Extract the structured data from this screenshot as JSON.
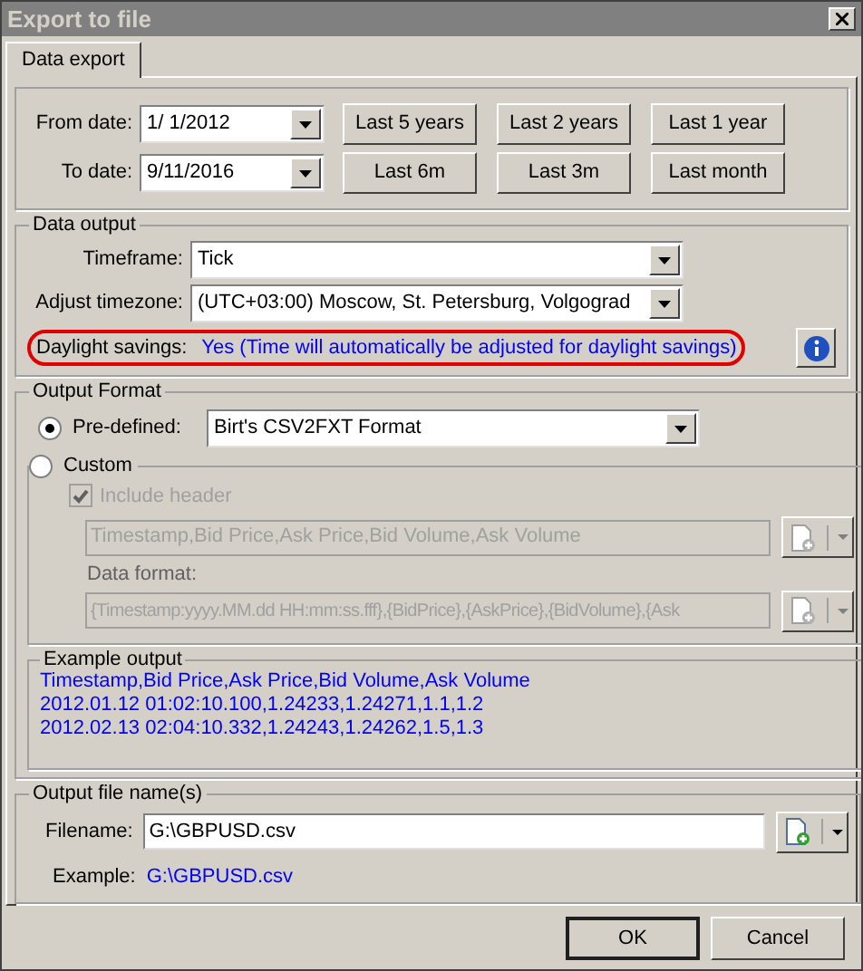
{
  "window": {
    "title": "Export to file"
  },
  "tabs": [
    {
      "label": "Data export",
      "selected": true
    }
  ],
  "date_range": {
    "from": {
      "label": "From date:",
      "value": "1/  1/2012"
    },
    "to": {
      "label": "To date:",
      "value": "9/11/2016"
    },
    "presets": [
      "Last 5 years",
      "Last 2 years",
      "Last 1 year",
      "Last 6m",
      "Last 3m",
      "Last month"
    ]
  },
  "data_output": {
    "title": "Data output",
    "timeframe": {
      "label": "Timeframe:",
      "value": "Tick"
    },
    "timezone": {
      "label": "Adjust timezone:",
      "value": "(UTC+03:00) Moscow, St. Petersburg, Volgograd"
    },
    "daylight": {
      "label": "Daylight savings:",
      "value": "Yes (Time will automatically be adjusted for daylight savings)",
      "highlighted": true
    }
  },
  "output_format": {
    "title": "Output Format",
    "options": [
      {
        "label": "Pre-defined:",
        "selected": true
      },
      {
        "label": "Custom",
        "selected": false
      }
    ],
    "predefined_value": "Birt's CSV2FXT Format",
    "custom": {
      "disabled": true,
      "include_header": {
        "label": "Include header",
        "checked": true
      },
      "header_value": "Timestamp,Bid Price,Ask Price,Bid Volume,Ask Volume",
      "data_format_label": "Data format:",
      "data_format_value": "{Timestamp:yyyy.MM.dd HH:mm:ss.fff},{BidPrice},{AskPrice},{BidVolume},{Ask"
    },
    "example": {
      "title": "Example output",
      "lines": [
        "Timestamp,Bid Price,Ask Price,Bid Volume,Ask Volume",
        "2012.01.12 01:02:10.100,1.24233,1.24271,1.1,1.2",
        "2012.02.13 02:04:10.332,1.24243,1.24262,1.5,1.3"
      ]
    }
  },
  "output_file": {
    "title": "Output file name(s)",
    "label": "Filename:",
    "value": "G:\\GBPUSD.csv",
    "example_label": "Example:",
    "example_value": "G:\\GBPUSD.csv"
  },
  "buttons": [
    {
      "label": "OK",
      "default": true
    },
    {
      "label": "Cancel",
      "default": false
    }
  ]
}
